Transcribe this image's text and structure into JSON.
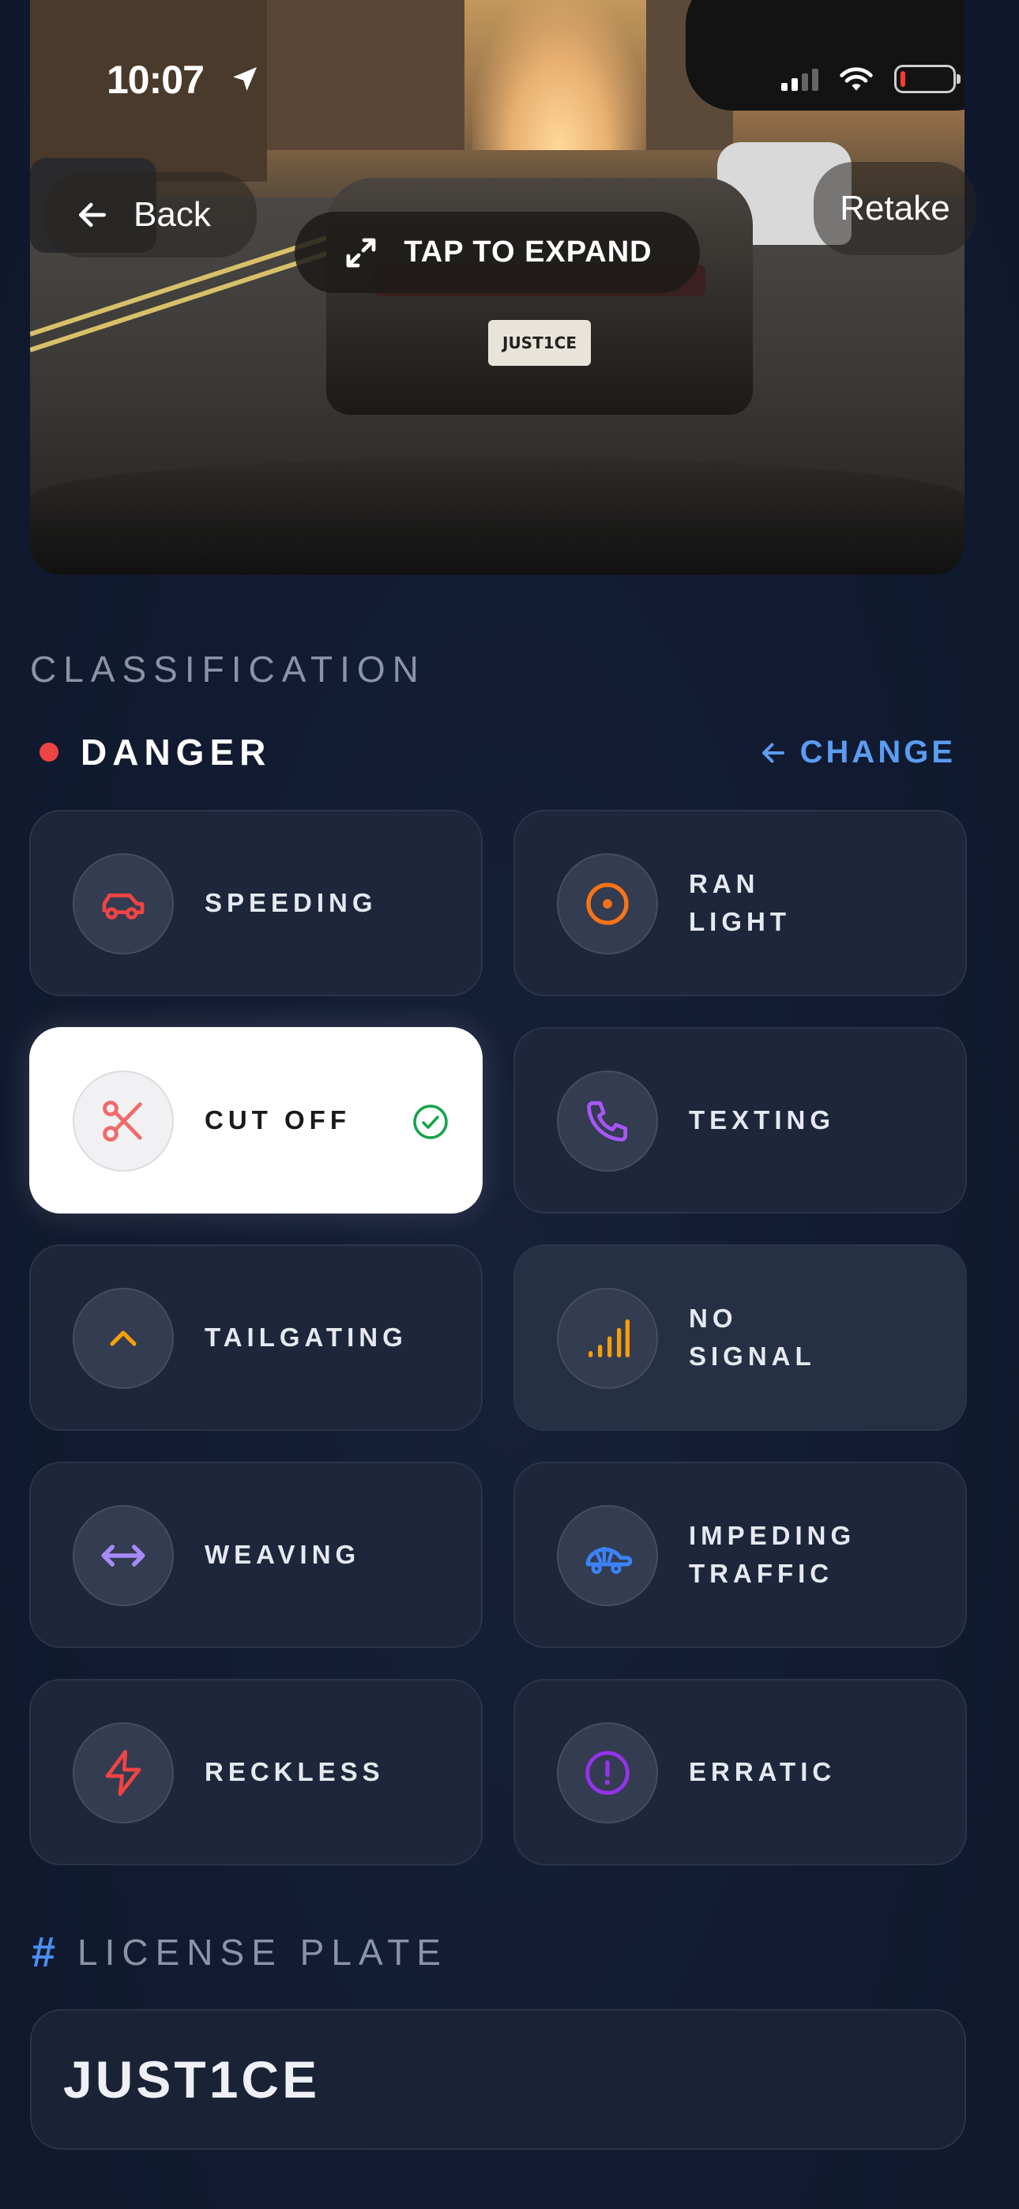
{
  "status_bar": {
    "time": "10:07"
  },
  "header": {
    "back_label": "Back",
    "retake_label": "Retake",
    "expand_label": "TAP TO EXPAND",
    "photo_plate_text": "JUST1CE"
  },
  "classification": {
    "section_label": "CLASSIFICATION",
    "severity": "DANGER",
    "severity_color": "#ef4444",
    "change_label": "CHANGE",
    "accent_color": "#5b9cf2",
    "options": [
      {
        "label": "SPEEDING",
        "icon": "car-icon",
        "color": "#ef4444",
        "selected": false
      },
      {
        "label": "RAN\nLIGHT",
        "icon": "target-icon",
        "color": "#f97316",
        "selected": false
      },
      {
        "label": "CUT OFF",
        "icon": "scissors-icon",
        "color": "#ef6b6b",
        "selected": true
      },
      {
        "label": "TEXTING",
        "icon": "phone-icon",
        "color": "#a855f7",
        "selected": false
      },
      {
        "label": "TAILGATING",
        "icon": "chevron-up-icon",
        "color": "#f59e0b",
        "selected": false
      },
      {
        "label": "NO\nSIGNAL",
        "icon": "signal-bars-icon",
        "color": "#f59e0b",
        "selected": false
      },
      {
        "label": "WEAVING",
        "icon": "arrows-horizontal-icon",
        "color": "#a78bfa",
        "selected": false
      },
      {
        "label": "IMPEDING\nTRAFFIC",
        "icon": "turtle-icon",
        "color": "#3b82f6",
        "selected": false
      },
      {
        "label": "RECKLESS",
        "icon": "lightning-icon",
        "color": "#ef4444",
        "selected": false
      },
      {
        "label": "ERRATIC",
        "icon": "alert-circle-icon",
        "color": "#9333ea",
        "selected": false
      }
    ]
  },
  "license_plate": {
    "section_label": "LICENSE PLATE",
    "value": "JUST1CE"
  }
}
